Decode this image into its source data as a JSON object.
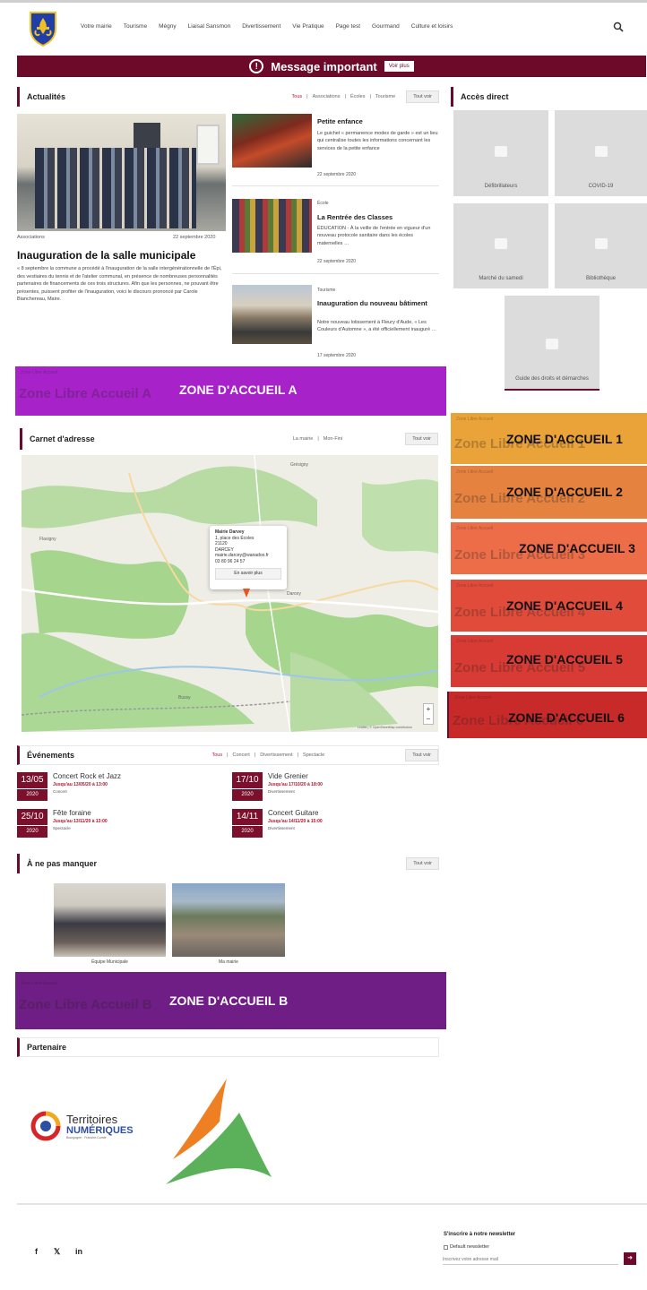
{
  "header": {
    "nav": [
      "Votre mairie",
      "Tourisme",
      "Mégny",
      "Liaisal Sansmon",
      "Divertissement",
      "Vie Pratique",
      "Page test",
      "Gourmand",
      "Culture et loisirs"
    ]
  },
  "message": {
    "title": "Message important",
    "button": "Voir plus"
  },
  "news": {
    "title": "Actualités",
    "filters": [
      "Tous",
      "Associations",
      "Écoles",
      "Tourisme"
    ],
    "all_label": "Tout voir",
    "main": {
      "category": "Associations",
      "date": "22 septembre 2020",
      "title": "Inauguration de la salle municipale",
      "text": "« 8 septembre la commune a procédé à l'inauguration de la salle intergénérationnelle de l'Épi, des vestiaires du tennis et de l'atelier communal, en présence de nombreuses personnalités partenaires de financements de ces trois structures. Afin que les personnes, ne pouvant être présentes, puissent profiter de l'inauguration, voici le discours prononcé par Carole Bianchereau, Maire."
    },
    "items": [
      {
        "category": "",
        "title": "Petite enfance",
        "text": "Le guichet « permanence modes de garde » est un lieu qui centralise toutes les informations concernant les services de la petite enfance",
        "date": "22 septembre 2020"
      },
      {
        "category": "École",
        "title": "La Rentrée des Classes",
        "text": "ÉDUCATION - À la veille de l'entrée en vigueur d'un nouveau protocole sanitaire dans les écoles maternelles …",
        "date": "22 septembre 2020"
      },
      {
        "category": "Tourisme",
        "title": "Inauguration du nouveau bâtiment",
        "text": "Notre nouveau lotissement à Fleury d'Aude, « Les Couleurs d'Automne », a été officiellement inauguré …",
        "date": "17 septembre 2020"
      }
    ]
  },
  "direct_access": {
    "title": "Accès direct",
    "tiles": [
      "Défibrillateurs",
      "COVID-19",
      "Marché du samedi",
      "Bibliothèque",
      "Guide des droits et démarches"
    ]
  },
  "zones": {
    "ghost_small": "Zone Libre Accueil",
    "a": {
      "ghost": "Zone Libre Accueil A",
      "label": "ZONE D'ACCUEIL A",
      "color": "#a722c8"
    },
    "side": [
      {
        "ghost": "Zone Libre Accueil 1",
        "label": "ZONE D'ACCUEIL 1",
        "color": "#eaa338"
      },
      {
        "ghost": "Zone Libre Accueil 2",
        "label": "ZONE D'ACCUEIL 2",
        "color": "#e6823f"
      },
      {
        "ghost": "Zone Libre Accueil 3",
        "label": "ZONE D'ACCUEIL 3",
        "color": "#ec6d47"
      },
      {
        "ghost": "Zone Libre Accueil 4",
        "label": "ZONE D'ACCUEIL 4",
        "color": "#e14c3a"
      },
      {
        "ghost": "Zone Libre Accueil 5",
        "label": "ZONE D'ACCUEIL 5",
        "color": "#d83b33"
      },
      {
        "ghost": "Zone Libre Accueil 6",
        "label": "ZONE D'ACCUEIL 6",
        "color": "#c82a2a"
      }
    ],
    "b": {
      "ghost": "Zone Libre Accueil B",
      "label": "ZONE D'ACCUEIL B",
      "color": "#6e1e84"
    }
  },
  "address_book": {
    "title": "Carnet d'adresse",
    "filters": [
      "La mairie",
      "Mon-Fini"
    ],
    "all_label": "Tout voir",
    "popup": {
      "name": "Mairie Darvey",
      "lines": [
        "1, place des Écoles",
        "21120",
        "DARCEY",
        "mairie.darcey@wanadoo.fr",
        "03 80 96 24 57"
      ],
      "button": "En savoir plus"
    },
    "zoom_in": "+",
    "zoom_out": "−",
    "attribution": "Leaflet | © OpenStreetMap contributors",
    "places": [
      "Darcey",
      "Grésigny",
      "Flavigny",
      "Bussy"
    ]
  },
  "events": {
    "title": "Événements",
    "filters": [
      "Tous",
      "Concert",
      "Divertissement",
      "Spectacle"
    ],
    "all_label": "Tout voir",
    "items": [
      {
        "day": "13/05",
        "year": "2020",
        "name": "Concert Rock et Jazz",
        "until": "Jusqu'au 13/05/20 à 13:00",
        "cat": "Concert"
      },
      {
        "day": "17/10",
        "year": "2020",
        "name": "Vide Grenier",
        "until": "Jusqu'au 17/10/20 à 18:00",
        "cat": "Divertissement"
      },
      {
        "day": "25/10",
        "year": "2020",
        "name": "Fête foraine",
        "until": "Jusqu'au 13/11/20 à 13:00",
        "cat": "Spectacle"
      },
      {
        "day": "14/11",
        "year": "2020",
        "name": "Concert Guitare",
        "until": "Jusqu'au 14/11/20 à 15:00",
        "cat": "Divertissement"
      }
    ]
  },
  "dont_miss": {
    "title": "À ne pas manquer",
    "all_label": "Tout voir",
    "items": [
      "Équipe Municipale",
      "Ma mairie"
    ]
  },
  "partners": {
    "title": "Partenaire",
    "logo1_line1": "Territoires",
    "logo1_line2": "NUMÉRIQUES",
    "logo1_line3": "Bourgogne · Franche-Comté"
  },
  "footer": {
    "newsletter_title": "S'inscrire à notre newsletter",
    "newsletter_default": "Default newsletter",
    "email_placeholder": "Inscrivez votre adresse mail",
    "social": [
      "f",
      "𝕏",
      "in"
    ],
    "submit_icon": "arrow-icon"
  }
}
